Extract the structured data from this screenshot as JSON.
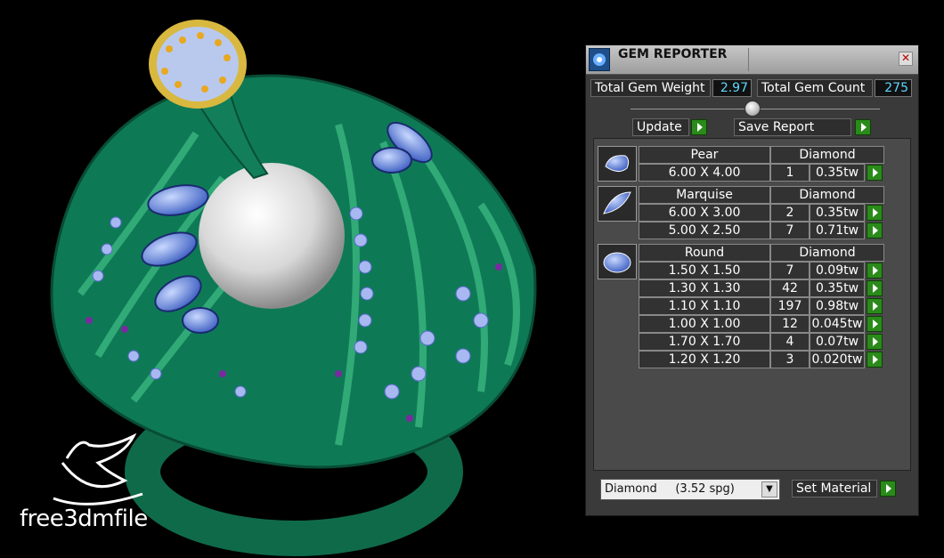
{
  "watermark": {
    "brand": "free3dmfile"
  },
  "panel": {
    "title": "GEM REPORTER",
    "total_weight_label": "Total Gem Weight",
    "total_weight_value": "2.97",
    "total_count_label": "Total Gem Count",
    "total_count_value": "275",
    "update_label": "Update",
    "save_report_label": "Save Report",
    "groups": [
      {
        "shape": "Pear",
        "material": "Diamond",
        "rows": [
          {
            "size": "6.00 X 4.00",
            "count": "1",
            "weight": "0.35tw"
          }
        ]
      },
      {
        "shape": "Marquise",
        "material": "Diamond",
        "rows": [
          {
            "size": "6.00 X 3.00",
            "count": "2",
            "weight": "0.35tw"
          },
          {
            "size": "5.00 X 2.50",
            "count": "7",
            "weight": "0.71tw"
          }
        ]
      },
      {
        "shape": "Round",
        "material": "Diamond",
        "rows": [
          {
            "size": "1.50 X 1.50",
            "count": "7",
            "weight": "0.09tw"
          },
          {
            "size": "1.30 X 1.30",
            "count": "42",
            "weight": "0.35tw"
          },
          {
            "size": "1.10 X 1.10",
            "count": "197",
            "weight": "0.98tw"
          },
          {
            "size": "1.00 X 1.00",
            "count": "12",
            "weight": "0.045tw"
          },
          {
            "size": "1.70 X 1.70",
            "count": "4",
            "weight": "0.07tw"
          },
          {
            "size": "1.20 X 1.20",
            "count": "3",
            "weight": "0.020tw"
          }
        ]
      }
    ],
    "material_select_value": "Diamond     (3.52 spg)",
    "set_material_label": "Set Material",
    "colors": {
      "value_text": "#5fd8ff",
      "go_button": "#2a8a1a"
    }
  }
}
